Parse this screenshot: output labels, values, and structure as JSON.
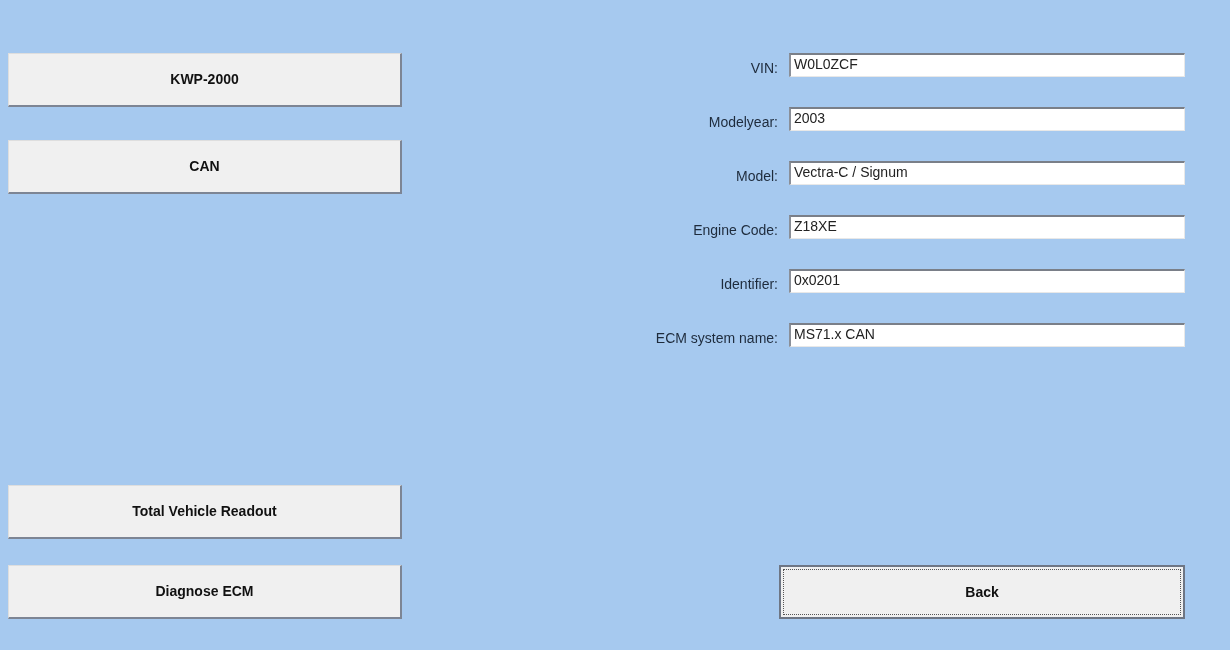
{
  "protocol_buttons": [
    {
      "label": "KWP-2000",
      "focused": false
    },
    {
      "label": "CAN",
      "focused": false
    }
  ],
  "action_buttons": [
    {
      "label": "Total Vehicle Readout",
      "focused": false
    },
    {
      "label": "Diagnose ECM",
      "focused": false
    }
  ],
  "vehicle_info": {
    "fields": [
      {
        "label": "VIN:",
        "value": "W0L0ZCF"
      },
      {
        "label": "Modelyear:",
        "value": "2003"
      },
      {
        "label": "Model:",
        "value": "Vectra-C / Signum"
      },
      {
        "label": "Engine Code:",
        "value": "Z18XE"
      },
      {
        "label": "Identifier:",
        "value": "0x0201"
      },
      {
        "label": "ECM system name:",
        "value": "MS71.x CAN"
      }
    ]
  },
  "back_button": {
    "label": "Back",
    "focused": true
  }
}
